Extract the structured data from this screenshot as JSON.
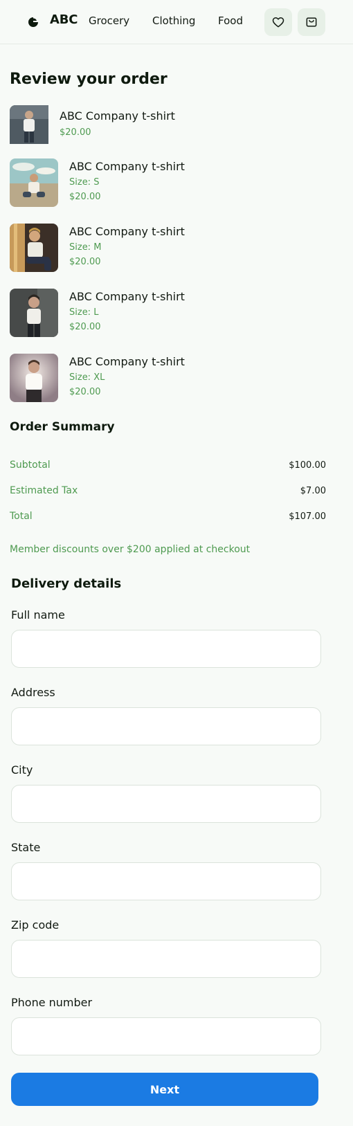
{
  "header": {
    "brand": "ABC",
    "nav": [
      "Grocery",
      "Clothing",
      "Food"
    ],
    "icons": [
      "heart-icon",
      "cart-icon"
    ]
  },
  "review": {
    "title": "Review your order",
    "items": [
      {
        "name": "ABC Company t-shirt",
        "size": "",
        "price": "$20.00"
      },
      {
        "name": "ABC Company t-shirt",
        "size": "Size: S",
        "price": "$20.00"
      },
      {
        "name": "ABC Company t-shirt",
        "size": "Size: M",
        "price": "$20.00"
      },
      {
        "name": "ABC Company t-shirt",
        "size": "Size: L",
        "price": "$20.00"
      },
      {
        "name": "ABC Company t-shirt",
        "size": "Size: XL",
        "price": "$20.00"
      }
    ]
  },
  "summary": {
    "title": "Order Summary",
    "rows": [
      {
        "label": "Subtotal",
        "value": "$100.00"
      },
      {
        "label": "Estimated Tax",
        "value": "$7.00"
      },
      {
        "label": "Total",
        "value": "$107.00"
      }
    ],
    "note": "Member discounts over $200 applied at checkout"
  },
  "delivery": {
    "title": "Delivery details",
    "fields": [
      {
        "label": "Full name",
        "value": ""
      },
      {
        "label": "Address",
        "value": ""
      },
      {
        "label": "City",
        "value": ""
      },
      {
        "label": "State",
        "value": ""
      },
      {
        "label": "Zip code",
        "value": ""
      },
      {
        "label": "Phone number",
        "value": ""
      }
    ]
  },
  "actions": {
    "next_label": "Next"
  },
  "colors": {
    "background": "#f7faf7",
    "accent_green": "#4e9a50",
    "icon_button_bg": "#e7f0e7",
    "primary_button": "#1b7be3"
  }
}
